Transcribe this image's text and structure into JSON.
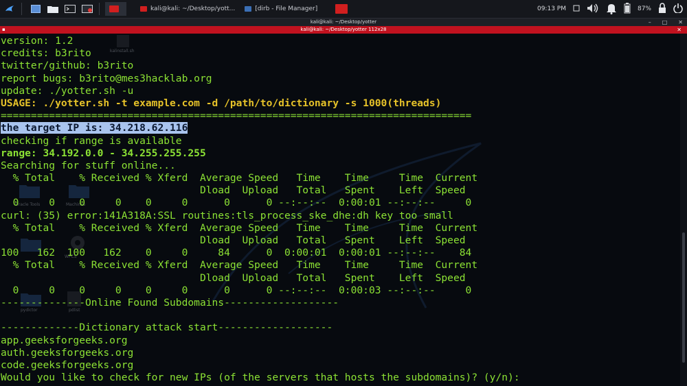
{
  "taskbar": {
    "windows": [
      {
        "label": "",
        "color": "#d11f1f"
      },
      {
        "label": "kali@kali: ~/Desktop/yott...",
        "color": "#d11f1f"
      },
      {
        "label": "[dirb - File Manager]",
        "color": "#3b6fb5"
      },
      {
        "label": "",
        "color": "#d11f1f"
      }
    ],
    "clock": "09:13 PM",
    "battery": "87%"
  },
  "window": {
    "title": "kali@kali: ~/Desktop/yotter",
    "tab_title": "kali@kali: ~/Desktop/yotter 112x28"
  },
  "desktop_labels": [
    "kalinstall.sh",
    "Oracle Tools",
    "Machines",
    "WPCS",
    "pydictor",
    "pdlist"
  ],
  "terminal": {
    "lines": [
      {
        "text": "version: 1.2",
        "style": "normal"
      },
      {
        "text": "credits: b3rito",
        "style": "normal"
      },
      {
        "text": "twitter/github: b3rito",
        "style": "normal"
      },
      {
        "text": "report bugs: b3rito@mes3hacklab.org",
        "style": "normal"
      },
      {
        "text": "update: ./yotter.sh -u",
        "style": "normal"
      },
      {
        "text": "USAGE: ./yotter.sh -t example.com -d /path/to/dictionary -s 1000(threads)",
        "style": "yellow"
      },
      {
        "text": "==============================================================================",
        "style": "normal"
      },
      {
        "text": "the target IP is: 34.218.62.116",
        "style": "highlight"
      },
      {
        "text": "checking if range is available",
        "style": "normal"
      },
      {
        "text": "range: 34.192.0.0 - 34.255.255.255",
        "style": "bold"
      },
      {
        "text": "Searching for stuff online...",
        "style": "normal"
      },
      {
        "text": "  % Total    % Received % Xferd  Average Speed   Time    Time     Time  Current",
        "style": "normal"
      },
      {
        "text": "                                 Dload  Upload   Total   Spent    Left  Speed",
        "style": "normal"
      },
      {
        "text": "  0     0    0     0    0     0      0      0 --:--:--  0:00:01 --:--:--     0",
        "style": "normal"
      },
      {
        "text": "curl: (35) error:141A318A:SSL routines:tls_process_ske_dhe:dh key too small",
        "style": "normal"
      },
      {
        "text": "  % Total    % Received % Xferd  Average Speed   Time    Time     Time  Current",
        "style": "normal"
      },
      {
        "text": "                                 Dload  Upload   Total   Spent    Left  Speed",
        "style": "normal"
      },
      {
        "text": "100   162  100   162    0     0     84      0  0:00:01  0:00:01 --:--:--    84",
        "style": "normal"
      },
      {
        "text": "  % Total    % Received % Xferd  Average Speed   Time    Time     Time  Current",
        "style": "normal"
      },
      {
        "text": "                                 Dload  Upload   Total   Spent    Left  Speed",
        "style": "normal"
      },
      {
        "text": "  0     0    0     0    0     0      0      0 --:--:--  0:00:03 --:--:--     0",
        "style": "normal"
      },
      {
        "text": "--------------Online Found Subdomains-------------------",
        "style": "normal"
      },
      {
        "text": "",
        "style": "normal"
      },
      {
        "text": "-------------Dictionary attack start-------------------",
        "style": "normal"
      },
      {
        "text": "app.geeksforgeeks.org",
        "style": "normal"
      },
      {
        "text": "auth.geeksforgeeks.org",
        "style": "normal"
      },
      {
        "text": "code.geeksforgeeks.org",
        "style": "normal"
      },
      {
        "text": "Would you like to check for new IPs (of the servers that hosts the subdomains)? (y/n):",
        "style": "normal"
      }
    ]
  },
  "colors": {
    "terminal_text": "#8ce234",
    "usage_text": "#e6c229",
    "selection_bg": "#a9c4ee",
    "tab_bar": "#c1121f"
  },
  "icons": {
    "launcher": "kali-dragon-icon",
    "tray": [
      "window-icon",
      "volume-icon",
      "notification-bell-icon",
      "battery-icon",
      "lock-icon",
      "power-icon"
    ]
  }
}
